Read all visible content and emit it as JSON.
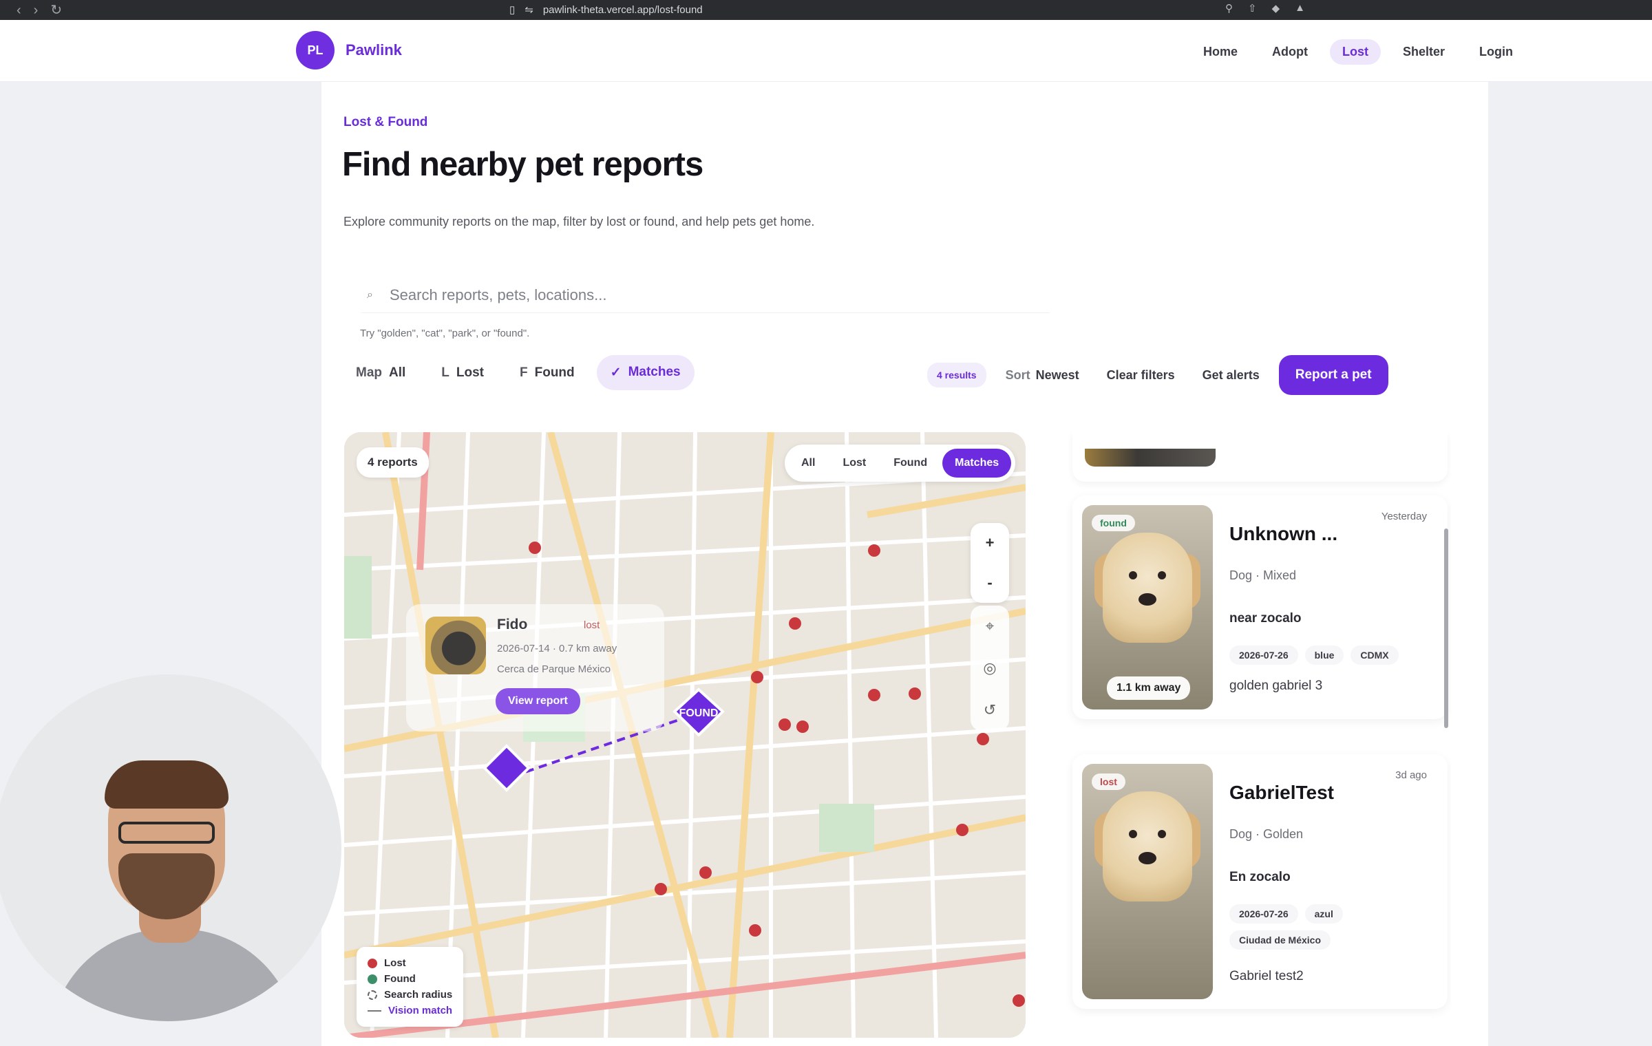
{
  "browser": {
    "url": "pawlink-theta.vercel.app/lost-found"
  },
  "brand": {
    "initials": "PL",
    "name": "Pawlink"
  },
  "nav": [
    {
      "label": "Home",
      "active": false
    },
    {
      "label": "Adopt",
      "active": false
    },
    {
      "label": "Lost",
      "active": true
    },
    {
      "label": "Shelter",
      "active": false
    },
    {
      "label": "Login",
      "active": false
    }
  ],
  "header": {
    "kicker": "Lost & Found",
    "title": "Find nearby pet reports",
    "subtitle": "Explore community reports on the map, filter by lost or found, and help pets get home."
  },
  "search": {
    "placeholder": "Search reports, pets, locations...",
    "hint": "Try \"golden\", \"cat\", \"park\", or \"found\"."
  },
  "filters": [
    {
      "key": "Map",
      "label": "All",
      "active": false
    },
    {
      "key": "L",
      "label": "Lost",
      "active": false
    },
    {
      "key": "F",
      "label": "Found",
      "active": false
    },
    {
      "key": "✓",
      "label": "Matches",
      "active": true
    }
  ],
  "controls": {
    "results": "4 results",
    "sort_label": "Sort",
    "sort_value": "Newest",
    "clear": "Clear filters",
    "alerts": "Get alerts",
    "report": "Report a pet"
  },
  "map": {
    "count": "4 reports",
    "tabs": [
      "All",
      "Lost",
      "Found",
      "Matches"
    ],
    "active_tab": "Matches",
    "found_marker": "FOUND",
    "popup": {
      "name": "Fido",
      "status": "lost",
      "meta": "2026-07-14 · 0.7 km away",
      "location": "Cerca de Parque México",
      "button": "View report"
    },
    "legend": {
      "lost": "Lost",
      "found": "Found",
      "radius": "Search radius",
      "vision": "Vision match"
    },
    "colors": {
      "lost": "#c8383d",
      "found": "#3d8f6a",
      "accent": "#6d2bdf"
    }
  },
  "results": [
    {
      "status": "found",
      "name": "Unknown ...",
      "time": "Yesterday",
      "breed": "Dog · Mixed",
      "location": "near zocalo",
      "tags": [
        "2026-07-26",
        "blue",
        "CDMX"
      ],
      "description": "golden gabriel 3",
      "distance": "1.1 km away"
    },
    {
      "status": "lost",
      "name": "GabrielTest",
      "time": "3d ago",
      "breed": "Dog · Golden",
      "location": "En zocalo",
      "tags": [
        "2026-07-26",
        "azul",
        "Ciudad de México"
      ],
      "description": "Gabriel test2",
      "distance": ""
    }
  ]
}
